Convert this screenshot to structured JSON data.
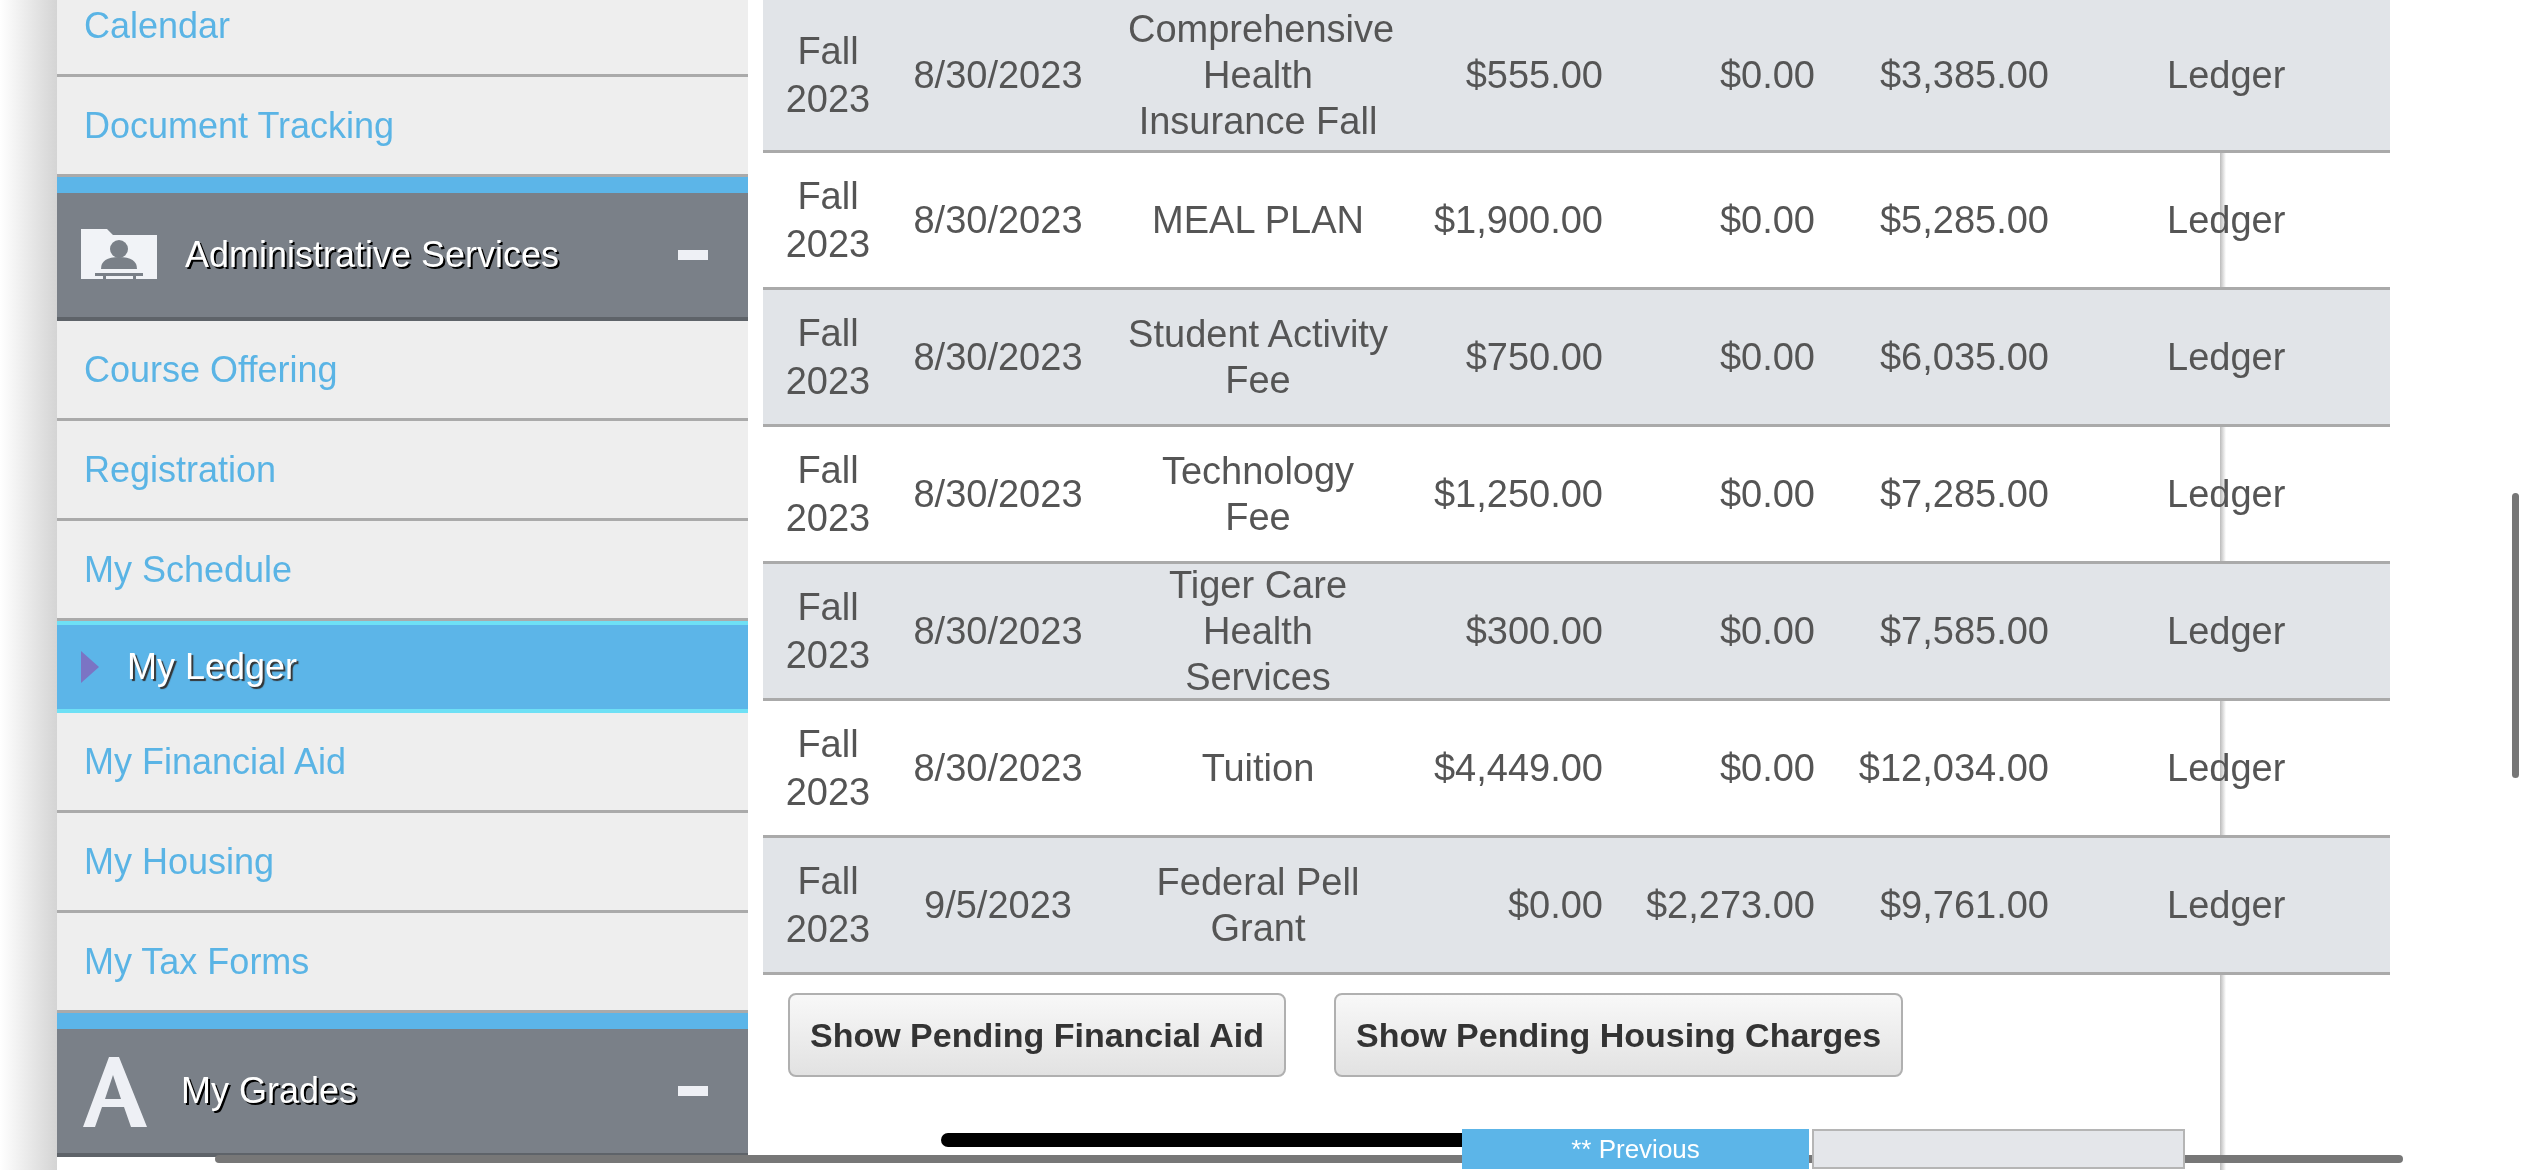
{
  "sidebar": {
    "items": [
      {
        "kind": "link",
        "label": "Calendar",
        "selected": false
      },
      {
        "kind": "link",
        "label": "Document Tracking",
        "selected": false
      },
      {
        "kind": "header",
        "label": "Administrative Services",
        "expanded": true
      },
      {
        "kind": "link",
        "label": "Course Offering",
        "selected": false
      },
      {
        "kind": "link",
        "label": "Registration",
        "selected": false
      },
      {
        "kind": "link",
        "label": "My Schedule",
        "selected": false
      },
      {
        "kind": "link",
        "label": "My Ledger",
        "selected": true
      },
      {
        "kind": "link",
        "label": "My Financial Aid",
        "selected": false
      },
      {
        "kind": "link",
        "label": "My Housing",
        "selected": false
      },
      {
        "kind": "link",
        "label": "My Tax Forms",
        "selected": false
      },
      {
        "kind": "header",
        "label": "My Grades",
        "expanded": true
      }
    ]
  },
  "ledger": {
    "rows": [
      {
        "term": "Fall 2023",
        "date": "8/30/2023",
        "description": "Comprehensive Health Insurance Fall",
        "charge": "$555.00",
        "payment": "$0.00",
        "balance": "$3,385.00",
        "link": "Ledger"
      },
      {
        "term": "Fall 2023",
        "date": "8/30/2023",
        "description": "MEAL PLAN",
        "charge": "$1,900.00",
        "payment": "$0.00",
        "balance": "$5,285.00",
        "link": "Ledger"
      },
      {
        "term": "Fall 2023",
        "date": "8/30/2023",
        "description": "Student Activity Fee",
        "charge": "$750.00",
        "payment": "$0.00",
        "balance": "$6,035.00",
        "link": "Ledger"
      },
      {
        "term": "Fall 2023",
        "date": "8/30/2023",
        "description": "Technology Fee",
        "charge": "$1,250.00",
        "payment": "$0.00",
        "balance": "$7,285.00",
        "link": "Ledger"
      },
      {
        "term": "Fall 2023",
        "date": "8/30/2023",
        "description": "Tiger Care Health Services",
        "charge": "$300.00",
        "payment": "$0.00",
        "balance": "$7,585.00",
        "link": "Ledger"
      },
      {
        "term": "Fall 2023",
        "date": "8/30/2023",
        "description": "Tuition",
        "charge": "$4,449.00",
        "payment": "$0.00",
        "balance": "$12,034.00",
        "link": "Ledger"
      },
      {
        "term": "Fall 2023",
        "date": "9/5/2023",
        "description": "Federal Pell Grant",
        "charge": "$0.00",
        "payment": "$2,273.00",
        "balance": "$9,761.00",
        "link": "Ledger"
      }
    ],
    "buttons": [
      "Show Pending Financial Aid",
      "Show Pending Housing Charges"
    ],
    "pager": {
      "previous": "** Previous"
    }
  }
}
